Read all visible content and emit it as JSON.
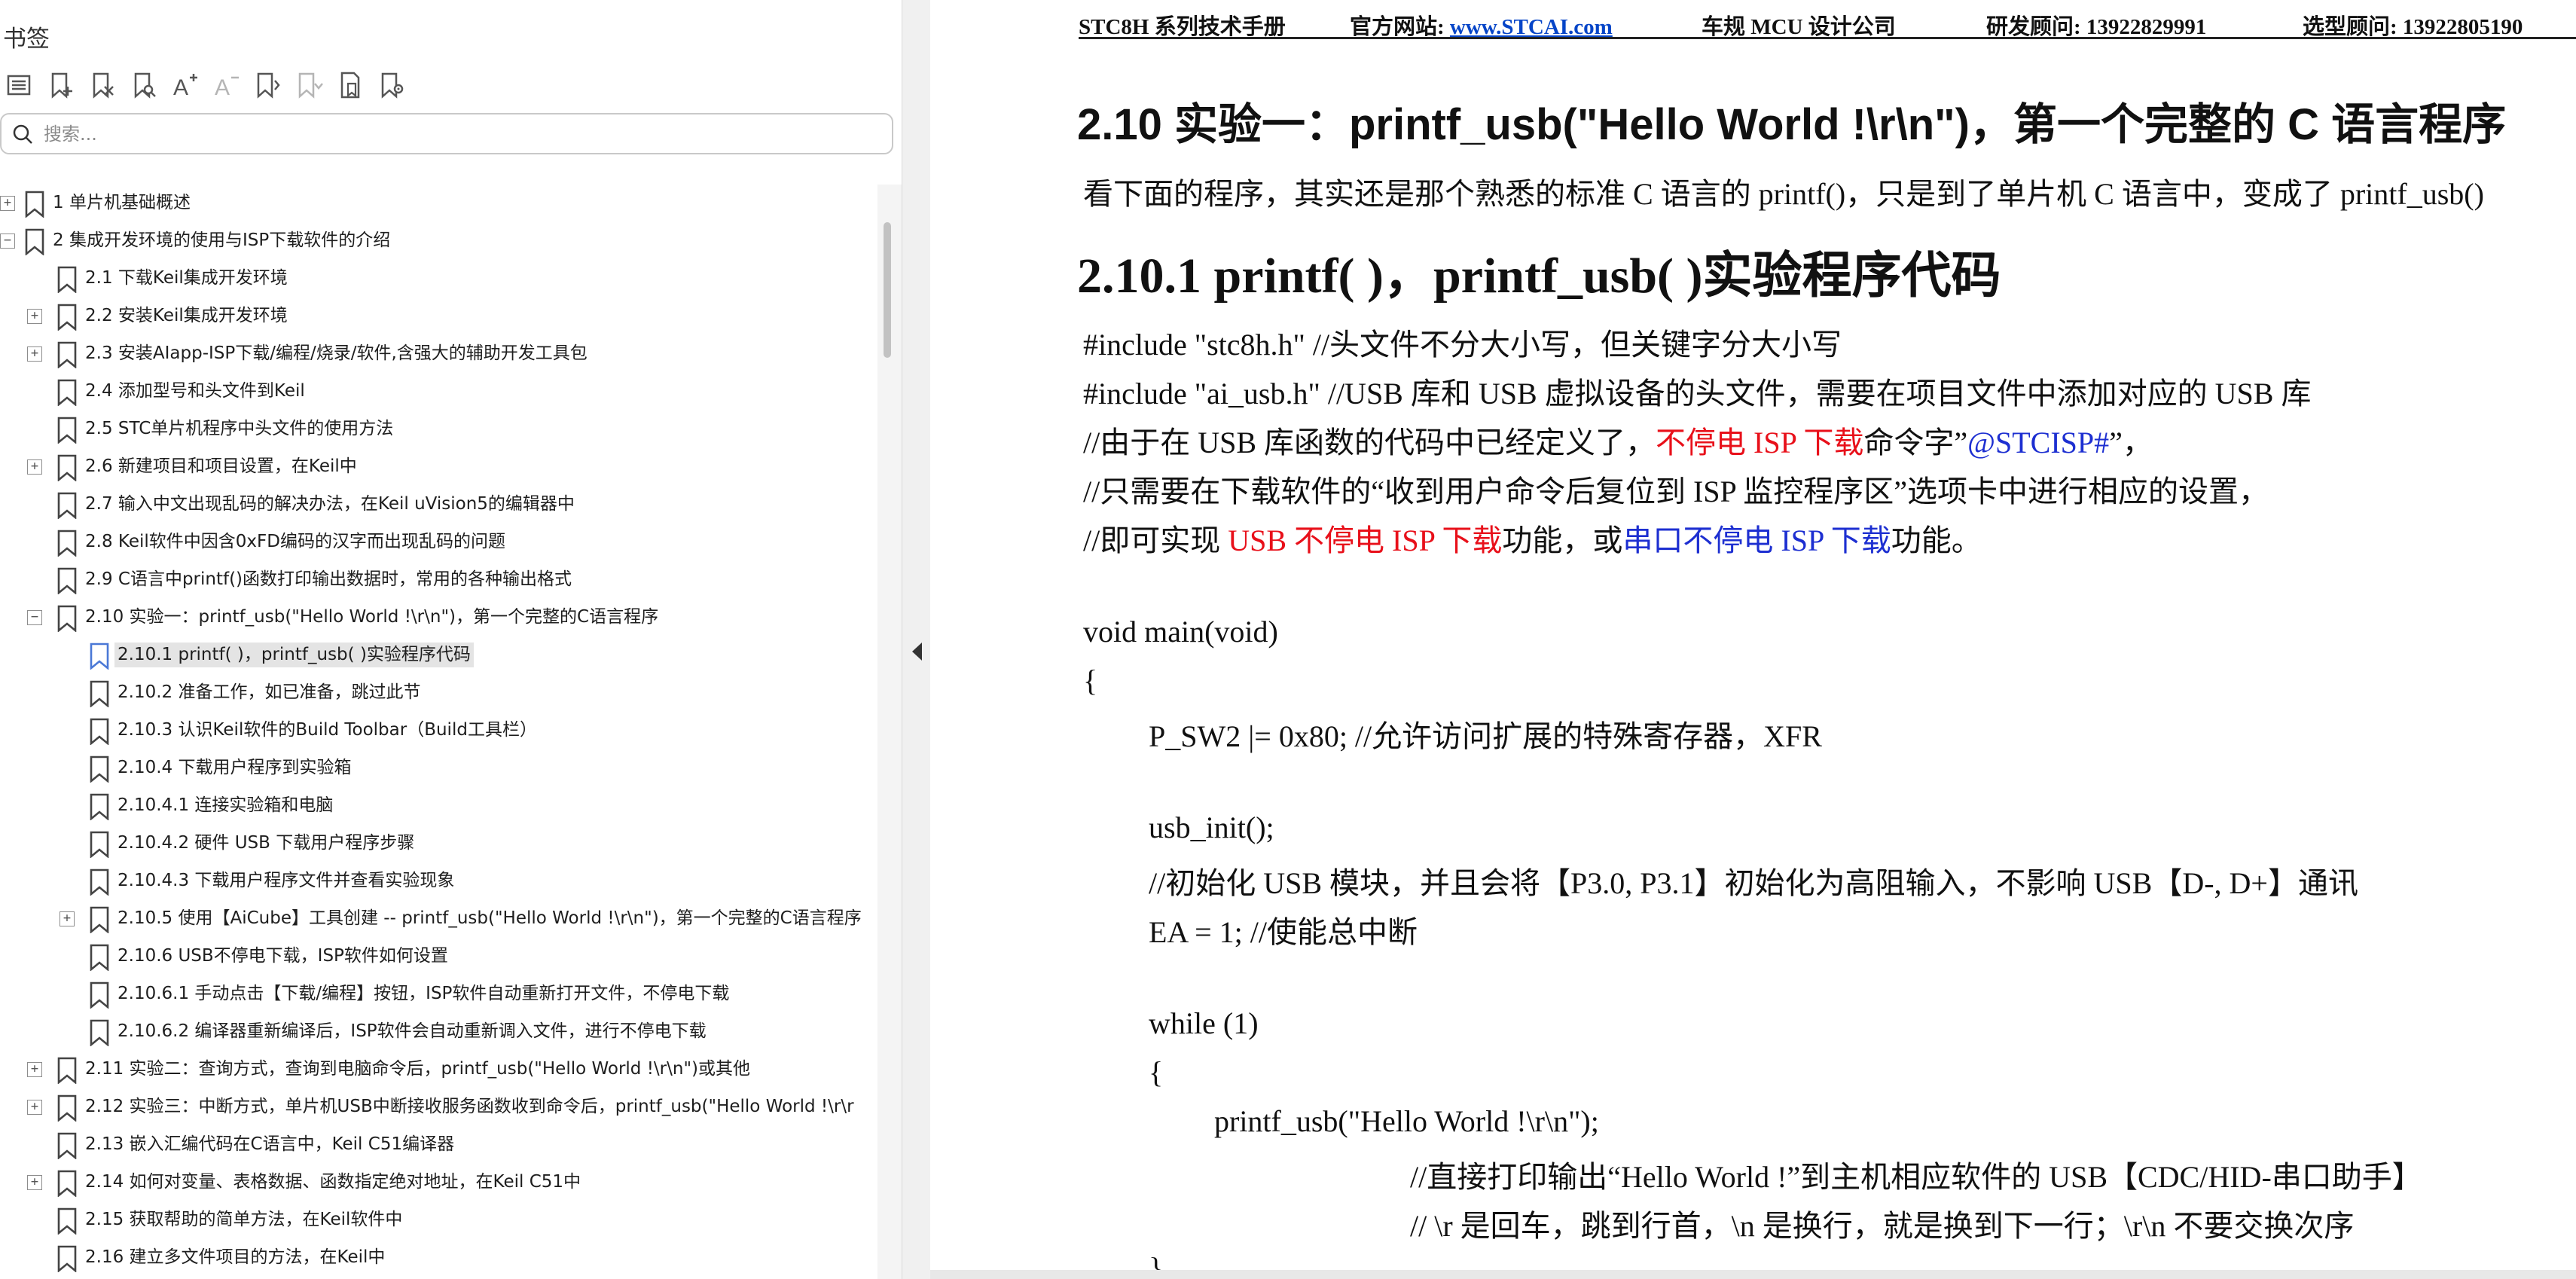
{
  "panel": {
    "title": "书签",
    "search_placeholder": "搜索..."
  },
  "toolbar_icons": [
    "list-options-icon",
    "add-bookmark-icon",
    "delete-bookmark-icon",
    "find-bookmark-icon",
    "expand-text-size-icon",
    "shrink-text-size-icon",
    "collapse-all-icon",
    "expand-all-icon",
    "bookmark-properties-icon",
    "bookmark-settings-icon"
  ],
  "bookmarks": [
    {
      "label": "1 单片机基础概述",
      "level": 0,
      "toggle": "+"
    },
    {
      "label": "2  集成开发环境的使用与ISP下载软件的介绍",
      "level": 0,
      "toggle": "-"
    },
    {
      "label": "2.1 下载Keil集成开发环境",
      "level": 1,
      "toggle": ""
    },
    {
      "label": "2.2  安装Keil集成开发环境",
      "level": 1,
      "toggle": "+"
    },
    {
      "label": "2.3  安装AIapp-ISP下载/编程/烧录/软件,含强大的辅助开发工具包",
      "level": 1,
      "toggle": "+"
    },
    {
      "label": "2.4  添加型号和头文件到Keil",
      "level": 1,
      "toggle": ""
    },
    {
      "label": "2.5  STC单片机程序中头文件的使用方法",
      "level": 1,
      "toggle": ""
    },
    {
      "label": "2.6  新建项目和项目设置，在Keil中",
      "level": 1,
      "toggle": "+"
    },
    {
      "label": "2.7  输入中文出现乱码的解决办法，在Keil uVision5的编辑器中",
      "level": 1,
      "toggle": ""
    },
    {
      "label": "2.8  Keil软件中因含0xFD编码的汉字而出现乱码的问题",
      "level": 1,
      "toggle": ""
    },
    {
      "label": "2.9  C语言中printf()函数打印输出数据时，常用的各种输出格式",
      "level": 1,
      "toggle": ""
    },
    {
      "label": "2.10  实验一：printf_usb(\"Hello World !\\r\\n\")，第一个完整的C语言程序",
      "level": 1,
      "toggle": "-"
    },
    {
      "label": "2.10.1 printf( )，printf_usb( )实验程序代码",
      "level": 2,
      "toggle": "",
      "selected": true
    },
    {
      "label": "2.10.2 准备工作，如已准备，跳过此节",
      "level": 2,
      "toggle": ""
    },
    {
      "label": "2.10.3  认识Keil软件的Build Toolbar（Build工具栏）",
      "level": 2,
      "toggle": ""
    },
    {
      "label": "2.10.4 下载用户程序到实验箱",
      "level": 2,
      "toggle": ""
    },
    {
      "label": "2.10.4.1 连接实验箱和电脑",
      "level": 2,
      "toggle": ""
    },
    {
      "label": "2.10.4.2 硬件 USB 下载用户程序步骤",
      "level": 2,
      "toggle": ""
    },
    {
      "label": "2.10.4.3  下载用户程序文件并查看实验现象",
      "level": 2,
      "toggle": ""
    },
    {
      "label": "2.10.5  使用【AiCube】工具创建 -- printf_usb(\"Hello World !\\r\\n\")，第一个完整的C语言程序",
      "level": 2,
      "toggle": "+"
    },
    {
      "label": "2.10.6  USB不停电下载，ISP软件如何设置",
      "level": 2,
      "toggle": ""
    },
    {
      "label": "2.10.6.1 手动点击【下载/编程】按钮，ISP软件自动重新打开文件，不停电下载",
      "level": 2,
      "toggle": ""
    },
    {
      "label": "2.10.6.2  编译器重新编译后，ISP软件会自动重新调入文件，进行不停电下载",
      "level": 2,
      "toggle": ""
    },
    {
      "label": "2.11  实验二：查询方式，查询到电脑命令后，printf_usb(\"Hello World !\\r\\n\")或其他",
      "level": 1,
      "toggle": "+"
    },
    {
      "label": "2.12  实验三：中断方式，单片机USB中断接收服务函数收到命令后，printf_usb(\"Hello World !\\r\\r",
      "level": 1,
      "toggle": "+"
    },
    {
      "label": "2.13 嵌入汇编代码在C语言中，Keil C51编译器",
      "level": 1,
      "toggle": ""
    },
    {
      "label": "2.14  如何对变量、表格数据、函数指定绝对地址，在Keil C51中",
      "level": 1,
      "toggle": "+"
    },
    {
      "label": "2.15  获取帮助的简单方法，在Keil软件中",
      "level": 1,
      "toggle": ""
    },
    {
      "label": "2.16  建立多文件项目的方法，在Keil中",
      "level": 1,
      "toggle": ""
    }
  ],
  "doc": {
    "header": {
      "manual": "STC8H 系列技术手册",
      "site_label": "官方网站: ",
      "site_link": "www.STCAI.com",
      "company": "车规 MCU 设计公司",
      "rd_contact": "研发顾问: 13922829991",
      "sel_contact": "选型顾问: 13922805190"
    },
    "section_title": "2.10     实验一：printf_usb(\"Hello World !\\r\\n\")，第一个完整的 C 语言程序",
    "intro": "看下面的程序，其实还是那个熟悉的标准 C 语言的 printf()，只是到了单片机 C 语言中，变成了 printf_usb()",
    "subsection_title": "2.10.1      printf( )，printf_usb( )实验程序代码",
    "code": {
      "l1": "#include    \"stc8h.h\"                //头文件不分大小写，但关键字分大小写",
      "l2": "#include    \"ai_usb.h\"              //USB 库和 USB 虚拟设备的头文件，需要在项目文件中添加对应的 USB 库",
      "l3a": "//由于在 USB 库函数的代码中已经定义了，",
      "l3b": "不停电 ISP 下载",
      "l3c": "命令字”",
      "l3d": "@STCISP#",
      "l3e": "”，",
      "l4": "//只需要在下载软件的“收到用户命令后复位到 ISP 监控程序区”选项卡中进行相应的设置，",
      "l5a": "//即可实现 ",
      "l5b": "USB 不停电 ISP 下载",
      "l5c": "功能，或",
      "l5d": "串口不停电 ISP 下载",
      "l5e": "功能。",
      "l6": "void    main(void)",
      "l7": "{",
      "l8": "P_SW2 |= 0x80;     //允许访问扩展的特殊寄存器，XFR",
      "l9": "usb_init();",
      "l10": "//初始化 USB 模块，并且会将【P3.0, P3.1】初始化为高阻输入，不影响 USB【D-, D+】通讯",
      "l11": "EA = 1;                    //使能总中断",
      "l12": "while (1)",
      "l13": "{",
      "l14": "printf_usb(\"Hello World !\\r\\n\");",
      "l15": "//直接打印输出“Hello World !”到主机相应软件的 USB【CDC/HID-串口助手】",
      "l16": "//    \\r 是回车，跳到行首，\\n 是换行，就是换到下一行；\\r\\n 不要交换次序",
      "l17": "}"
    }
  }
}
